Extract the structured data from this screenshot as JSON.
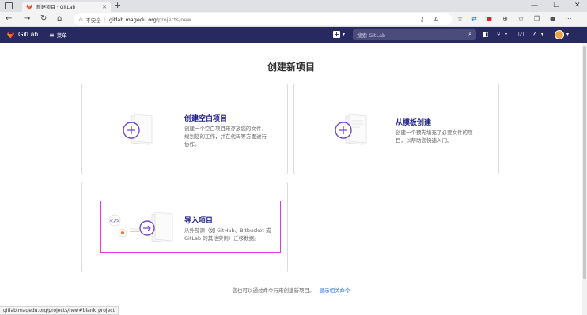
{
  "browser": {
    "tab_title": "新建项目 · GitLab",
    "tab_close": "✕",
    "new_tab": "+",
    "window_controls": [
      "—",
      "☐",
      "✕"
    ],
    "security_label": "不安全",
    "url_host": "gitlab.magedu.org",
    "url_path": "/projects/new",
    "status_url": "gitlab.magedu.org/projects/new#blank_project"
  },
  "gitlab": {
    "brand": "GitLab",
    "menu_label": "菜单",
    "search_placeholder": "搜索 GitLab",
    "colors": {
      "header": "#292961",
      "accent": "#1f1f8a",
      "link": "#1f75cb",
      "highlight": "#e633e6"
    }
  },
  "main": {
    "title": "创建新项目",
    "cards": [
      {
        "title": "创建空白项目",
        "description_lines": [
          "创建一个空白项目来存放您的文件，",
          "规划您的工作，并在代码等方面进行",
          "协作。"
        ],
        "icon": "plus-document-icon"
      },
      {
        "title": "从模板创建",
        "description_lines": [
          "创建一个预先填充了必要文件的项",
          "目，以帮助您快速入门。"
        ],
        "icon": "template-document-icon"
      },
      {
        "title": "导入项目",
        "description_lines": [
          "从外部源（如 GitHub、Bitbucket 或",
          "GitLab 的其他实例）迁移数据。"
        ],
        "icon": "import-document-icon"
      }
    ],
    "footer_text": "您也可以通过命令行来创建新项目。",
    "footer_link": "显示相关命令"
  }
}
